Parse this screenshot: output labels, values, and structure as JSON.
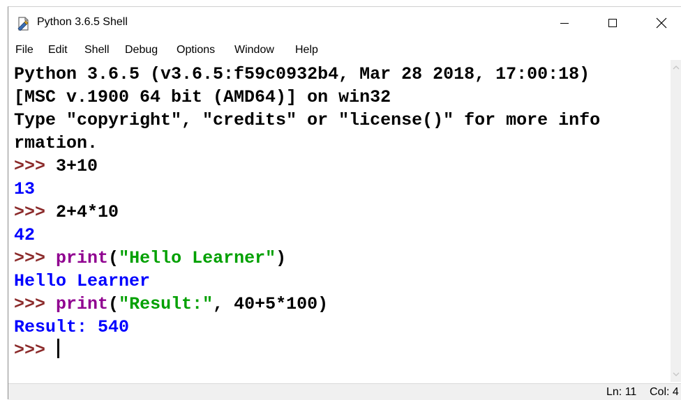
{
  "window": {
    "title": "Python 3.6.5 Shell"
  },
  "menu": [
    "File",
    "Edit",
    "Shell",
    "Debug",
    "Options",
    "Window",
    "Help"
  ],
  "shell": {
    "banner": [
      "Python 3.6.5 (v3.6.5:f59c0932b4, Mar 28 2018, 17:00:18)",
      "[MSC v.1900 64 bit (AMD64)] on win32",
      "Type \"copyright\", \"credits\" or \"license()\" for more info",
      "rmation."
    ],
    "prompt": ">>>",
    "entries": [
      {
        "input": "3+10",
        "output": "13"
      },
      {
        "input": "2+4*10",
        "output": "42"
      },
      {
        "input_func": "print",
        "input_open": "(",
        "input_str": "\"Hello Learner\"",
        "input_close": ")",
        "output": "Hello Learner"
      },
      {
        "input_func": "print",
        "input_open": "(",
        "input_str": "\"Result:\"",
        "input_close": ", 40+5*100)",
        "output": "Result: 540"
      }
    ]
  },
  "status": {
    "line": "Ln: 11",
    "col": "Col: 4"
  },
  "colors": {
    "prompt": "#8b2a2a",
    "result": "#0000ff",
    "builtin": "#900090",
    "string": "#00a000"
  },
  "icons": {
    "app": "idle-python-icon",
    "minimize": "minimize-icon",
    "maximize": "maximize-icon",
    "close": "close-icon"
  }
}
